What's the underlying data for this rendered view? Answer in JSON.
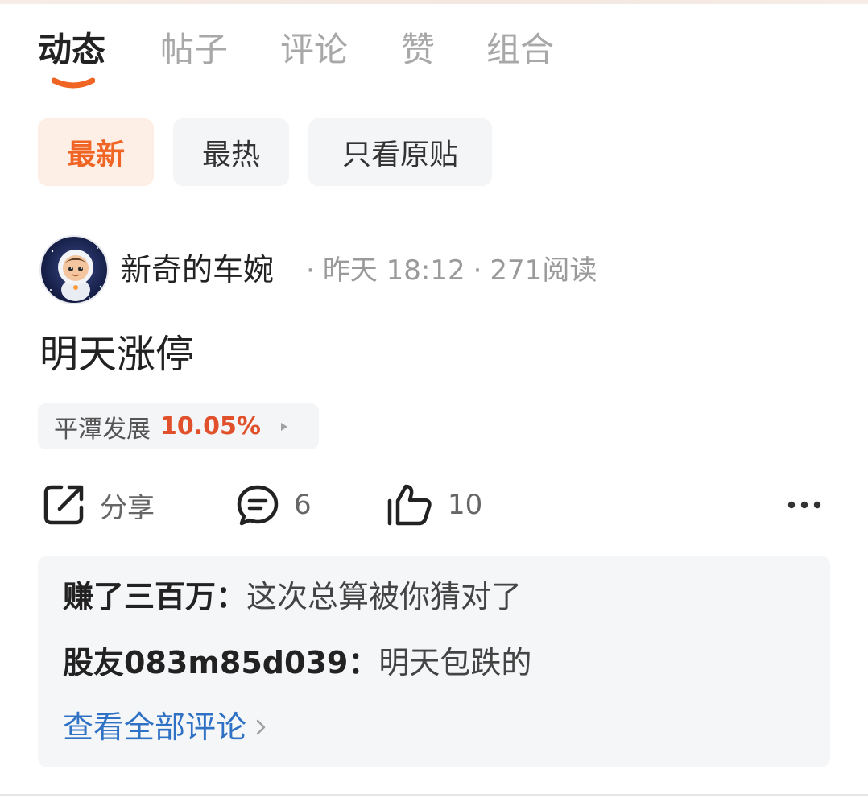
{
  "tabs": [
    {
      "label": "动态",
      "active": true
    },
    {
      "label": "帖子",
      "active": false
    },
    {
      "label": "评论",
      "active": false
    },
    {
      "label": "赞",
      "active": false
    },
    {
      "label": "组合",
      "active": false
    }
  ],
  "filters": [
    {
      "label": "最新",
      "active": true
    },
    {
      "label": "最热",
      "active": false
    },
    {
      "label": "只看原贴",
      "active": false
    }
  ],
  "post": {
    "author": "新奇的车婉",
    "time": "昨天 18:12",
    "reads": "271阅读",
    "separator": "·",
    "text": "明天涨停",
    "stock": {
      "name": "平潭发展",
      "change": "10.05%"
    },
    "actions": {
      "share_label": "分享",
      "comment_count": "6",
      "like_count": "10"
    }
  },
  "comments": [
    {
      "user": "赚了三百万",
      "text": "这次总算被你猜对了"
    },
    {
      "user": "股友083m85d039",
      "text": "明天包跌的"
    }
  ],
  "view_all_label": "查看全部评论",
  "colors": {
    "accent": "#f06424",
    "stock_up": "#e0502a",
    "link": "#2f71c4"
  }
}
